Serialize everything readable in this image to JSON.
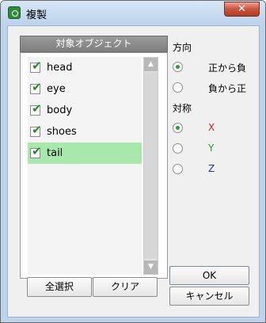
{
  "window": {
    "title": "複製",
    "close_label": "✕"
  },
  "objects": {
    "header": "対象オブジェクト",
    "items": [
      {
        "label": "head",
        "checked": true,
        "selected": false
      },
      {
        "label": "eye",
        "checked": true,
        "selected": false
      },
      {
        "label": "body",
        "checked": true,
        "selected": false
      },
      {
        "label": "shoes",
        "checked": true,
        "selected": false
      },
      {
        "label": "tail",
        "checked": true,
        "selected": true
      }
    ],
    "select_all_label": "全選択",
    "clear_label": "クリア"
  },
  "direction": {
    "label": "方向",
    "options": [
      {
        "label": "正から負",
        "checked": true
      },
      {
        "label": "負から正",
        "checked": false
      }
    ]
  },
  "symmetry": {
    "label": "対称",
    "options": [
      {
        "label": "X",
        "checked": true,
        "color": "#cc2222"
      },
      {
        "label": "Y",
        "checked": false,
        "color": "#2a9a2a"
      },
      {
        "label": "Z",
        "checked": false,
        "color": "#2233bb"
      }
    ]
  },
  "actions": {
    "ok_label": "OK",
    "cancel_label": "キャンセル"
  },
  "icons": {
    "app": "app-icon",
    "check": "check-icon",
    "scroll_up": "scroll-up-arrow-icon",
    "scroll_down": "scroll-down-arrow-icon"
  }
}
